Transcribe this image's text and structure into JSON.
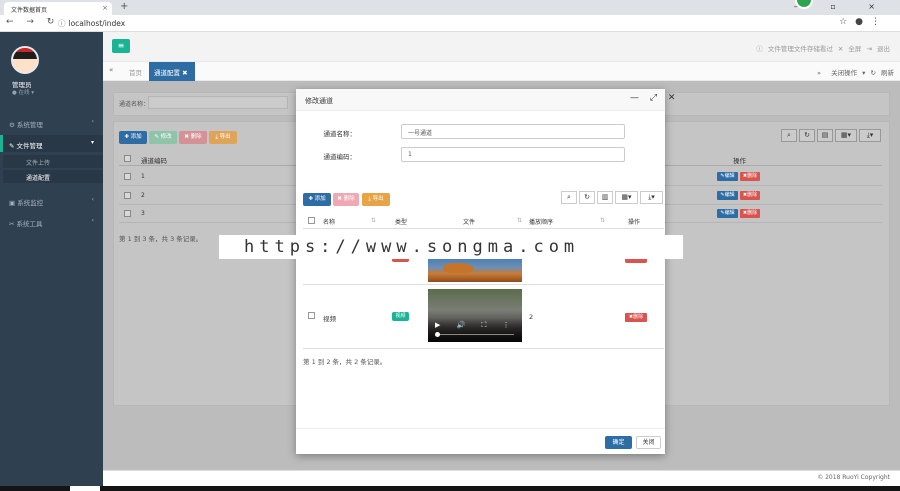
{
  "browser": {
    "tab_title": "文件数据首页",
    "url": "localhost/index",
    "tab_close": "×",
    "new_tab": "+",
    "window_controls": "– ▫ ×",
    "nav_buttons": "← → ↻",
    "url_icon": "ⓘ",
    "star": "☆",
    "account": "●",
    "menu": "⋮"
  },
  "sidebar": {
    "user_name": "管理员",
    "user_status": "● 在线 ▾",
    "menu": [
      {
        "label": "⚙ 系统管理",
        "caret": "‹"
      },
      {
        "label": "✎ 文件管理",
        "caret": "▾"
      },
      {
        "label": "▣ 系统监控",
        "caret": "‹"
      },
      {
        "label": "✂ 系统工具",
        "caret": "‹"
      }
    ],
    "submenu": [
      "文件上传",
      "通道配置"
    ]
  },
  "topbar": {
    "menu_icon": "≡",
    "right_text": "ⓘ 文件管理文件存储看过 ✕ 全屏 ⇥ 退出"
  },
  "tabs": {
    "prev": "«",
    "home": "首页",
    "active": "通道配置",
    "active_close": "✖",
    "next": "»",
    "actions": "关闭操作 ▾",
    "refresh": "↻ 刷新"
  },
  "background": {
    "search_label": "通道名称：",
    "toolbar": [
      {
        "label": "✚ 添加",
        "color": "#2e6da4"
      },
      {
        "label": "✎ 修改",
        "color": "#8fc4a8"
      },
      {
        "label": "✖ 删除",
        "color": "#d49296"
      },
      {
        "label": "⤓ 导出",
        "color": "#e0a458"
      }
    ],
    "tool_icons": [
      "⌕",
      "↻",
      "▤",
      "▦▾",
      "⤓▾"
    ],
    "headers": {
      "name": "通道编码",
      "ops": "操作"
    },
    "rows": [
      "1",
      "2",
      "3"
    ],
    "row_edit": "✎编辑",
    "row_delete": "✖删除",
    "pagination": "第 1 到 3 条，共 3 条记录。"
  },
  "modal": {
    "title": "修改通道",
    "controls": "— ⤢ ✕",
    "fields": [
      {
        "label": "通道名称：",
        "value": "一号通道"
      },
      {
        "label": "通道编码：",
        "value": "1"
      }
    ],
    "toolbar": [
      {
        "label": "✚ 添加",
        "color": "#2e6da4"
      },
      {
        "label": "✖ 删除",
        "color": "#f0a8b2"
      },
      {
        "label": "⤓ 导出",
        "color": "#e7a445"
      }
    ],
    "tool_icons": [
      "⌕",
      "↻",
      "▥",
      "▦▾",
      "⤓▾"
    ],
    "headers": [
      "名称",
      "类型",
      "文件",
      "播放顺序",
      "操作"
    ],
    "sort_icon": "⇅",
    "rows": [
      {
        "name": "视频",
        "type": "视频",
        "order": "2",
        "action": "✖删除"
      }
    ],
    "video_controls": "▶ 🔊 ⛶ ⋮",
    "pagination": "第 1 到 2 条，共 2 条记录。",
    "ok": "确定",
    "close": "关闭"
  },
  "watermark": "https://www.songma.com",
  "footer": {
    "copyright": "© 2018 RuoYi Copyright"
  }
}
